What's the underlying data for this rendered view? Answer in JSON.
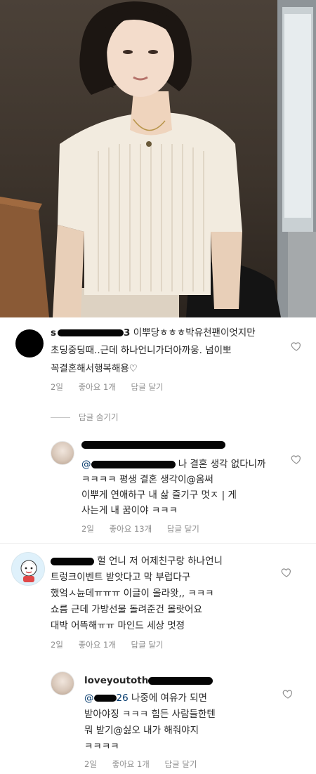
{
  "post": {
    "image_alt": "woman in white ribbed knit top"
  },
  "comments": [
    {
      "username_visible": "s",
      "username_tail": "3",
      "lines": [
        "이뿌당ㅎㅎㅎ박유천팬이엇지만",
        "초딩중딩때..근데 하나언니가더아까웅. 넘이뽀",
        "꼭결혼해서행복해용♡"
      ],
      "time": "2일",
      "likes": "좋아요 1개",
      "reply": "답글 달기"
    },
    {
      "username_visible": "",
      "mention": "@",
      "lines": [
        "나 결혼 생각 없다니까",
        "ㅋㅋㅋㅋ 평생 결혼 생각이@옴써",
        "이뿌게 연애하구 내 삶 즐기구 멋ㅈ | 게",
        "사는게 내 꿈이야 ㅋㅋㅋ"
      ],
      "time": "2일",
      "likes": "좋아요 13개",
      "reply": "답글 달기"
    },
    {
      "username_visible": "",
      "lines": [
        "헐 언니 저 어제친구랑 하나언니",
        "트렁크이벤트 받앗다고 막 부럽다구",
        "했엌ㅅ뉸데ㅠㅠㅠ 이글이 올라왓,, ㅋㅋㅋ",
        "쇼름 근데 가방선물 돌려준건 몰랏어요",
        "대박 어뜩해ㅠㅠ 마인드 세상 멋졍"
      ],
      "time": "2일",
      "likes": "좋아요 1개",
      "reply": "답글 달기"
    },
    {
      "username_visible": "loveyoutoth",
      "mention": "@",
      "mention_tail": "26",
      "lines": [
        "나중에 여유가 되면",
        "받아야징 ㅋㅋㅋ 힘든 사람들한텐",
        "뭐 받기@싫오 내가 해줘야지",
        "ㅋㅋㅋㅋ"
      ],
      "time": "2일",
      "likes": "좋아요 1개",
      "reply": "답글 달기"
    }
  ],
  "hide_replies": "답글 숨기기",
  "colors": {
    "text": "#262626",
    "meta": "#8e8e8e",
    "mention": "#00376b"
  }
}
